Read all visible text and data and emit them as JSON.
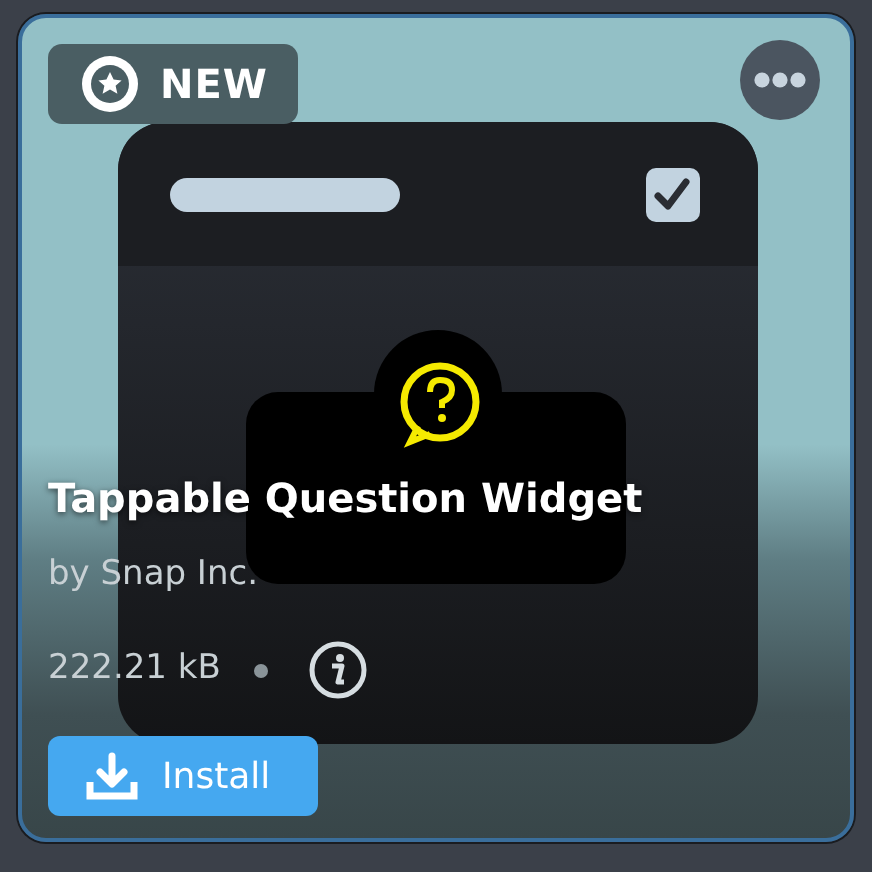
{
  "badge": {
    "label": "NEW"
  },
  "title": "Tappable Question Widget",
  "author": "by Snap Inc.",
  "size": "222.21 kB",
  "install_button": {
    "label": "Install"
  }
}
